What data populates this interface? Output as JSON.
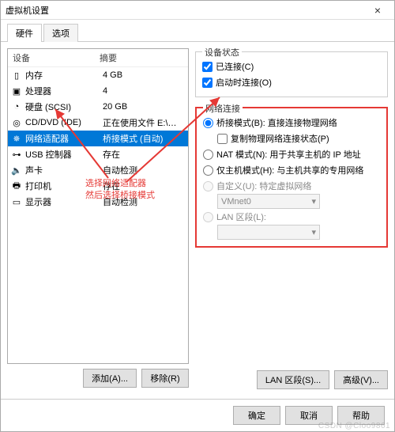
{
  "window": {
    "title": "虚拟机设置",
    "close": "×"
  },
  "tabs": {
    "hardware": "硬件",
    "options": "选项"
  },
  "columns": {
    "device": "设备",
    "summary": "摘要"
  },
  "devices": [
    {
      "name": "内存",
      "summary": "4 GB",
      "glyph": "▯"
    },
    {
      "name": "处理器",
      "summary": "4",
      "glyph": "▣"
    },
    {
      "name": "硬盘 (SCSI)",
      "summary": "20 GB",
      "glyph": "◔"
    },
    {
      "name": "CD/DVD (IDE)",
      "summary": "正在使用文件 E:\\镜像\\CentO...",
      "glyph": "◎"
    },
    {
      "name": "网络适配器",
      "summary": "桥接模式 (自动)",
      "glyph": "✵"
    },
    {
      "name": "USB 控制器",
      "summary": "存在",
      "glyph": "⊶"
    },
    {
      "name": "声卡",
      "summary": "自动检测",
      "glyph": "🔈"
    },
    {
      "name": "打印机",
      "summary": "存在",
      "glyph": "🖶"
    },
    {
      "name": "显示器",
      "summary": "自动检测",
      "glyph": "▭"
    }
  ],
  "leftButtons": {
    "add": "添加(A)...",
    "remove": "移除(R)"
  },
  "status": {
    "group": "设备状态",
    "connected": "已连接(C)",
    "connectAtPower": "启动时连接(O)"
  },
  "net": {
    "group": "网络连接",
    "bridge": "桥接模式(B): 直接连接物理网络",
    "replicate": "复制物理网络连接状态(P)",
    "nat": "NAT 模式(N): 用于共享主机的 IP 地址",
    "hostonly": "仅主机模式(H): 与主机共享的专用网络",
    "custom": "自定义(U): 特定虚拟网络",
    "vmnet": "VMnet0",
    "lan": "LAN 区段(L):"
  },
  "rightButtons": {
    "lan": "LAN 区段(S)...",
    "adv": "高级(V)..."
  },
  "footer": {
    "ok": "确定",
    "cancel": "取消",
    "help": "帮助"
  },
  "annotation": {
    "line1": "选择网络适配器",
    "line2": "然后选择桥接模式"
  },
  "watermark": "CSDN @Cloo9861"
}
